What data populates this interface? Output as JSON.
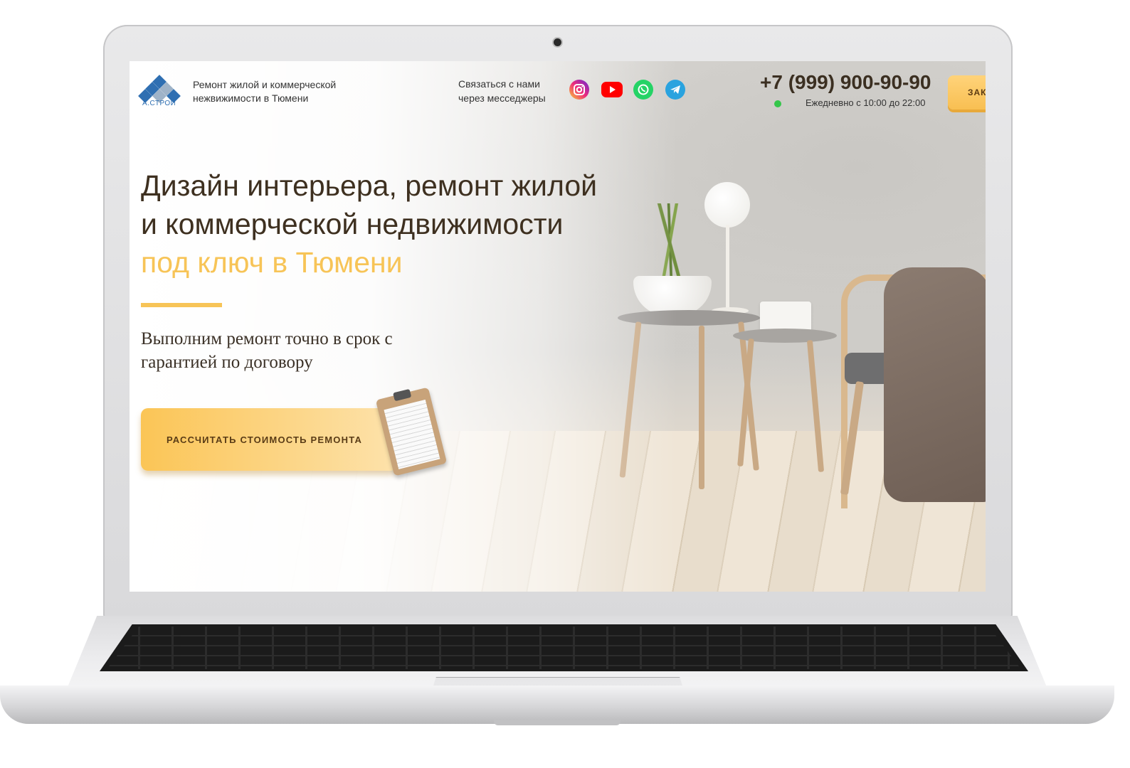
{
  "site": {
    "logo_caption": "А.СТРОЙ",
    "tagline": "Ремонт жилой и коммерческой нежвижимости в Тюмени",
    "contact_label": "Связаться с нами через месседжеры",
    "socials": [
      {
        "name": "instagram",
        "icon": "instagram-icon",
        "color": "#d62976"
      },
      {
        "name": "youtube",
        "icon": "youtube-icon",
        "color": "#ff0000"
      },
      {
        "name": "whatsapp",
        "icon": "whatsapp-icon",
        "color": "#25d366"
      },
      {
        "name": "telegram",
        "icon": "telegram-icon",
        "color": "#2aa3df"
      }
    ],
    "phone": "+7 (999) 900-90-90",
    "hours": "Ежедневно с 10:00 до 22:00",
    "order_button": "ЗАК"
  },
  "hero": {
    "headline_line1": "Дизайн интерьера, ремонт жилой",
    "headline_line2": "и коммерческой недвижимости",
    "headline_accent": "под ключ в Тюмени",
    "subline": "Выполним ремонт точно в срок с гарантией по договору",
    "cta_label": "РАССЧИТАТЬ СТОИМОСТЬ РЕМОНТА"
  },
  "colors": {
    "accent": "#f7c457",
    "heading": "#3e3020",
    "status_online": "#34c64a"
  }
}
